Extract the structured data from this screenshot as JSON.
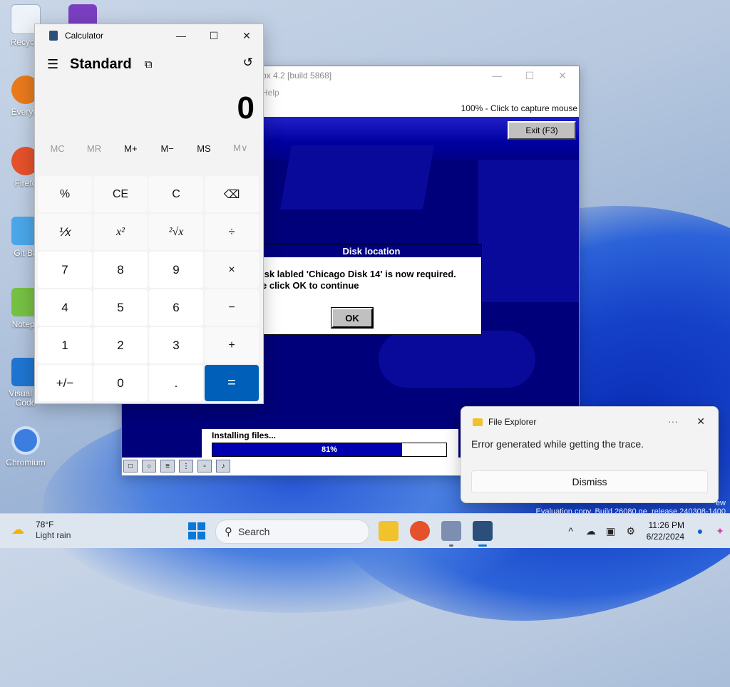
{
  "desktop": {
    "icons": [
      {
        "label": "Recycle",
        "color": "#e8eef6"
      },
      {
        "label": "Everyth",
        "color": "#e87a1c"
      },
      {
        "label": "Firefo",
        "color": "#e5512b"
      },
      {
        "label": "Git Ba",
        "color": "#4aa7e8"
      },
      {
        "label": "Notepa",
        "color": "#76c043"
      },
      {
        "label": "Visual St\nCode",
        "color": "#1f75d0"
      },
      {
        "label": "Chromium",
        "color": "#3b7ee0"
      }
    ]
  },
  "vbox": {
    "title": "ox 4.2 [build 5868]",
    "menu": "Help",
    "status": "100% - Click to capture mouse",
    "exit_label": "Exit (F3)",
    "dialog": {
      "title": "Disk location",
      "line1": "isk labled 'Chicago Disk 14' is now required.",
      "line2": "e click OK to continue",
      "ok": "OK"
    },
    "installer": {
      "label": "Installing files...",
      "percent_text": "81%",
      "progress": 0.81
    }
  },
  "calculator": {
    "title": "Calculator",
    "mode": "Standard",
    "display": "0",
    "memory": [
      "MC",
      "MR",
      "M+",
      "M−",
      "MS",
      "M∨"
    ],
    "keys": [
      "%",
      "CE",
      "C",
      "⌫",
      "⅟x",
      "x²",
      "²√x",
      "÷",
      "7",
      "8",
      "9",
      "×",
      "4",
      "5",
      "6",
      "−",
      "1",
      "2",
      "3",
      "+",
      "+/−",
      "0",
      ".",
      "="
    ]
  },
  "toast": {
    "app": "File Explorer",
    "message": "Error generated while getting the trace.",
    "dismiss": "Dismiss"
  },
  "watermark": {
    "line1": "ew",
    "line2": "Evaluation copy. Build 26080.ge_release.240308-1400"
  },
  "taskbar": {
    "temp": "78°F",
    "weather": "Light rain",
    "search_placeholder": "Search",
    "time": "11:26 PM",
    "date": "6/22/2024"
  }
}
